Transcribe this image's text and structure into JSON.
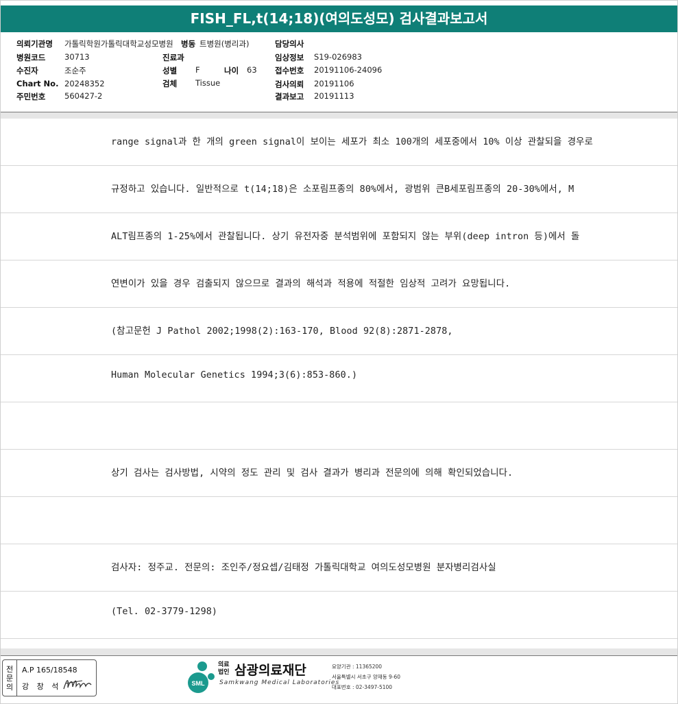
{
  "title": "FISH_FL,t(14;18)(여의도성모) 검사결과보고서",
  "header": {
    "institution_label": "의뢰기관명",
    "institution_value": "가톨릭학원가톨릭대학교성모병원",
    "ward_label": "병동",
    "ward_value": "트병원(병리과)",
    "hospital_code_label": "병원코드",
    "hospital_code_value": "30713",
    "patient_label": "수진자",
    "patient_value": "조순주",
    "chart_label": "Chart No.",
    "chart_value": "20248352",
    "rrn_label": "주민번호",
    "rrn_value": "560427-2",
    "dept_label": "진료과",
    "dept_value": "",
    "sex_label": "성별",
    "sex_value": "F",
    "age_label": "나이",
    "age_value": "63",
    "specimen_label": "검체",
    "specimen_value": "Tissue",
    "doctor_label": "담당의사",
    "doctor_value": "",
    "clinical_label": "임상정보",
    "clinical_value": "S19-026983",
    "receipt_label": "접수번호",
    "receipt_value": "20191106-24096",
    "request_label": "검사의뢰",
    "request_value": "20191106",
    "report_label": "결과보고",
    "report_value": "20191113"
  },
  "body_lines": [
    "range signal과 한 개의 green signal이 보이는 세포가 최소 100개의 세포중에서 10% 이상 관찰되을 경우로",
    " 규정하고 있습니다. 일반적으로 t(14;18)은 소포림프종의 80%에서, 광범위 큰B세포림프종의 20-30%에서, M",
    "ALT림프종의 1-25%에서 관찰됩니다. 상기 유전자중 분석범위에 포함되지 않는 부위(deep intron 등)에서 돌",
    "연변이가 있을 경우 검출되지 않으므로 결과의 해석과 적용에 적절한 임상적 고려가 요망됩니다.",
    "(참고문헌 J Pathol 2002;1998(2):163-170, Blood 92(8):2871-2878,",
    "Human Molecular Genetics 1994;3(6):853-860.)",
    "",
    "상기 검사는 검사방법, 시약의 정도 관리 및 검사 결과가 병리과 전문의에 의해 확인되었습니다.",
    "",
    "검사자: 정주교. 전문의: 조인주/정요셉/김태정 가톨릭대학교 여의도성모병원 분자병리검사실",
    "(Tel. 02-3779-1298)"
  ],
  "footer": {
    "sig_vertical": [
      "전",
      "문",
      "의"
    ],
    "sig_line1": "A.P 165/18548",
    "sig_line2": "강 창 석",
    "logo_corp_line1": "의료",
    "logo_corp_line2": "법인",
    "logo_name": "삼광의료재단",
    "logo_mark_text": "SML",
    "logo_english": "Samkwang Medical Laboratories",
    "info_line1": "요양기관 : 11365200",
    "info_line2": "서울특별시 서초구 양재동 9-60",
    "info_line3": "대표번호 : 02-3497-5100"
  },
  "colors": {
    "title_bg": "#0f7f77",
    "logo_mark": "#1b9a8e"
  }
}
